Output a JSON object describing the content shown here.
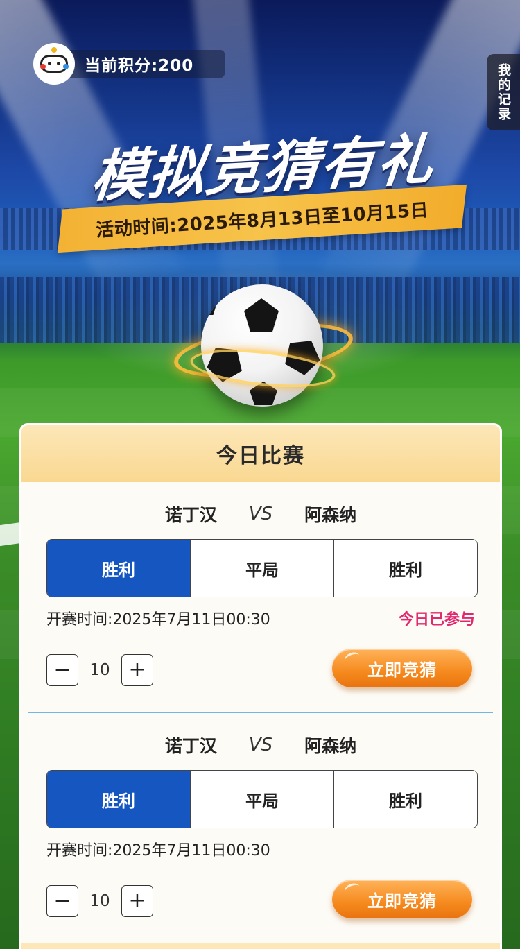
{
  "header": {
    "points_text": "当前积分:200",
    "record_tab": "我的记录",
    "title": "模拟竞猜有礼",
    "date_banner": "活动时间:2025年8月13日至10月15日"
  },
  "card": {
    "title": "今日比赛",
    "matches": [
      {
        "home": "诺丁汉",
        "vs": "VS",
        "away": "阿森纳",
        "options": [
          "胜利",
          "平局",
          "胜利"
        ],
        "selected_index": 0,
        "start_time": "开赛时间:2025年7月11日00:30",
        "status": "今日已参与",
        "stepper_minus": "−",
        "stepper_value": "10",
        "stepper_plus": "+",
        "action": "立即竞猜"
      },
      {
        "home": "诺丁汉",
        "vs": "VS",
        "away": "阿森纳",
        "options": [
          "胜利",
          "平局",
          "胜利"
        ],
        "selected_index": 0,
        "start_time": "开赛时间:2025年7月11日00:30",
        "status": "",
        "stepper_minus": "−",
        "stepper_value": "10",
        "stepper_plus": "+",
        "action": "立即竞猜"
      }
    ]
  },
  "colors": {
    "selected_option": "#1556c0",
    "status_text": "#e0286e",
    "action_button": "#f58a1e",
    "card_header": "#fde7b8",
    "date_banner": "#f3b234"
  },
  "icons": [
    "avatar-logo-icon",
    "minus-icon",
    "plus-icon",
    "football-icon"
  ]
}
